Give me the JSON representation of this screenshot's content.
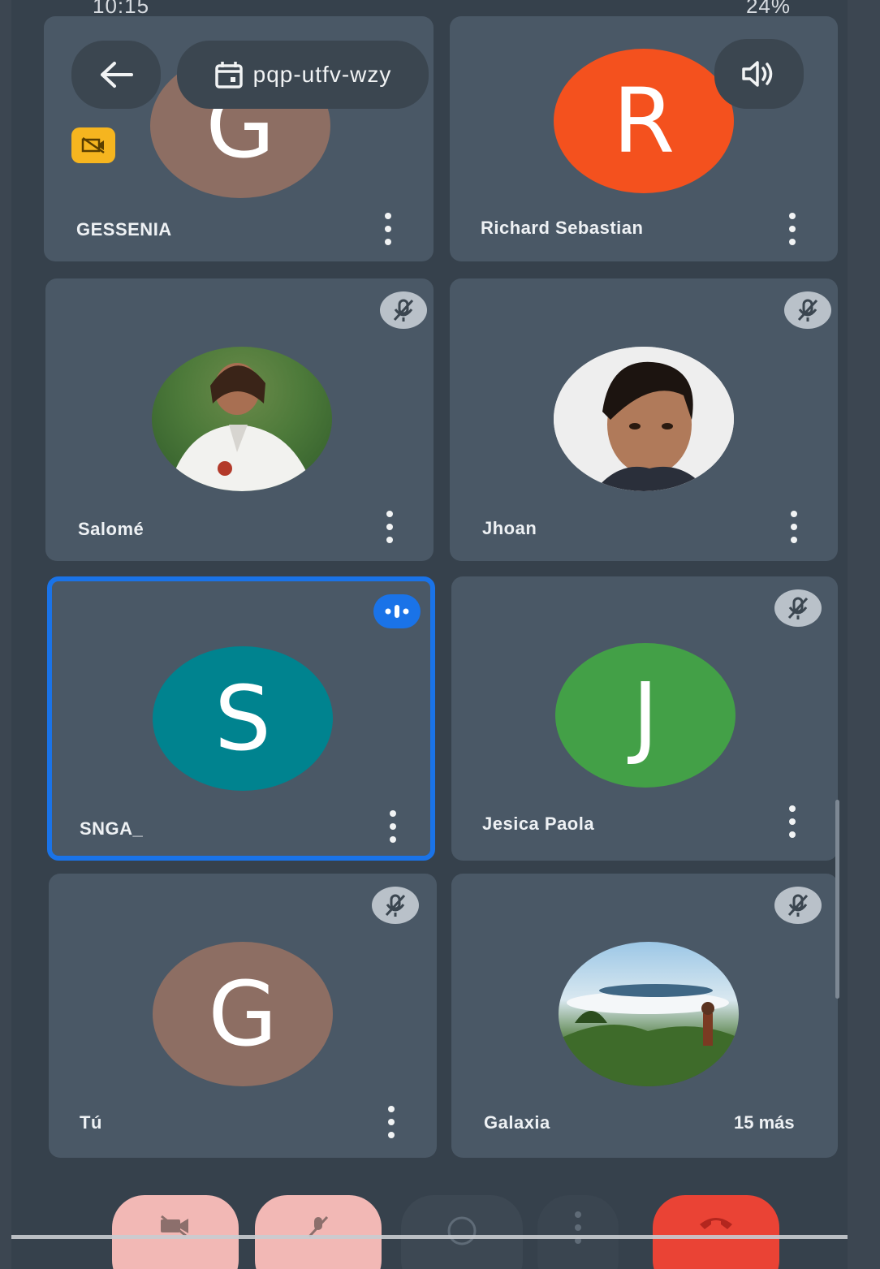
{
  "status": {
    "time": "10:15",
    "battery": "24%"
  },
  "header": {
    "meeting_code": "pqp-utfv-wzy"
  },
  "participants": [
    {
      "name": "GESSENIA",
      "initial": "G",
      "color": "#8d6e63"
    },
    {
      "name": "Richard Sebastian",
      "initial": "R",
      "color": "#f4511e"
    },
    {
      "name": "Salomé",
      "initial": "",
      "color": "#5a8a4a",
      "photo": true,
      "muted": true
    },
    {
      "name": "Jhoan",
      "initial": "",
      "color": "#e8e8e8",
      "photo": true,
      "muted": true
    },
    {
      "name": "SNGA_",
      "initial": "S",
      "color": "#00838f",
      "speaking": true
    },
    {
      "name": "Jesica Paola",
      "initial": "J",
      "color": "#43a047",
      "muted": true
    },
    {
      "name": "Tú",
      "initial": "G",
      "color": "#8d6e63",
      "muted": true
    },
    {
      "name": "Galaxia",
      "initial": "",
      "color": "#7cb1d8",
      "photo": true,
      "muted": true
    }
  ],
  "overflow_label": "15 más",
  "colors": {
    "active_border": "#1a73e8",
    "end_call": "#ea4335",
    "tile_bg": "#4a5866"
  }
}
